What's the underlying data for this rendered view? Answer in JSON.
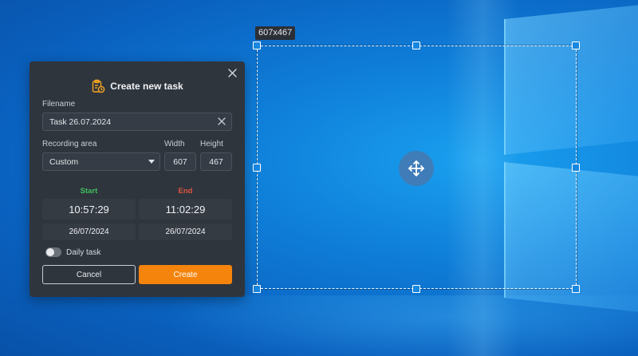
{
  "selection": {
    "size_label": "607x467"
  },
  "dialog": {
    "title": "Create new task",
    "filename_label": "Filename",
    "filename_value": "Task 26.07.2024",
    "recording_area_label": "Recording area",
    "recording_area_value": "Custom",
    "width_label": "Width",
    "width_value": "607",
    "height_label": "Height",
    "height_value": "467",
    "start_label": "Start",
    "end_label": "End",
    "start_time": "10:57:29",
    "end_time": "11:02:29",
    "start_date": "26/07/2024",
    "end_date": "26/07/2024",
    "daily_task_label": "Daily task",
    "daily_task_on": false,
    "cancel_label": "Cancel",
    "create_label": "Create"
  },
  "colors": {
    "accent": "#f5840c",
    "start": "#3fbf5f",
    "end": "#e0533f",
    "dialog_bg": "#2f353d"
  },
  "icons": {
    "title": "task-clipboard-clock-icon",
    "close": "close-icon",
    "clear": "clear-x-icon",
    "dropdown": "caret-down-icon",
    "move": "move-arrows-icon"
  }
}
